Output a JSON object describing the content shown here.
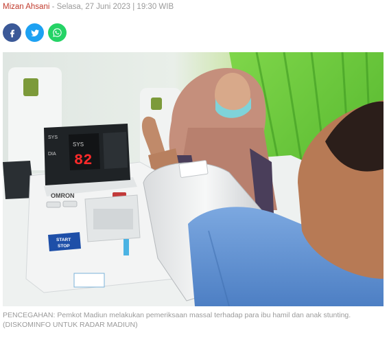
{
  "article": {
    "author": "Mizan Ahsani",
    "separator": " - ",
    "date": "Selasa, 27 Juni 2023 | 19:30 WIB"
  },
  "share": [
    {
      "network": "facebook",
      "icon": "facebook-icon",
      "color": "#3b5998"
    },
    {
      "network": "twitter",
      "icon": "twitter-icon",
      "color": "#1da1f2"
    },
    {
      "network": "whatsapp",
      "icon": "whatsapp-icon",
      "color": "#25d366"
    }
  ],
  "photo": {
    "device_display_value": "82",
    "device_brand": "OMRON",
    "device_start_label": "START",
    "device_stop_label": "STOP",
    "device_sys_label": "SYS",
    "device_dia_label": "DIA"
  },
  "caption": {
    "text": "PENCEGAHAN: Pemkot Madiun melakukan pemeriksaan massal terhadap para ibu hamil dan anak stunting.",
    "credit": "(DISKOMINFO UNTUK RADAR MADIUN)"
  }
}
